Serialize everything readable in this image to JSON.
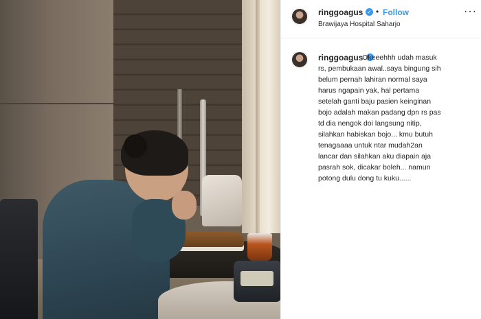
{
  "post": {
    "username": "ringgoagus",
    "follow_label": "Follow",
    "separator": "•",
    "location": "Brawijaya Hospital Saharjo",
    "verified_icon": "verified-icon",
    "more_icon": "more-options-icon",
    "more_glyph": "···",
    "verified_glyph": "✓",
    "caption_indent": "                      ",
    "caption": "Okeeehhh udah masuk\nrs, pembukaan awal..saya bingung sih\nbelum pernah lahiran normal saya\nharus ngapain yak, hal pertama\nsetelah ganti baju pasien keinginan\nbojo adalah makan padang dpn rs pas\ntd dia nengok doi langsung nitip,\nsilahkan habiskan bojo... kmu butuh\ntenagaaaa untuk ntar mudah2an\nlancar dan silahkan aku diapain aja\npasrah sok, dicakar boleh... namun\npotong dulu dong tu kuku......",
    "accent_color": "#3897f0"
  }
}
